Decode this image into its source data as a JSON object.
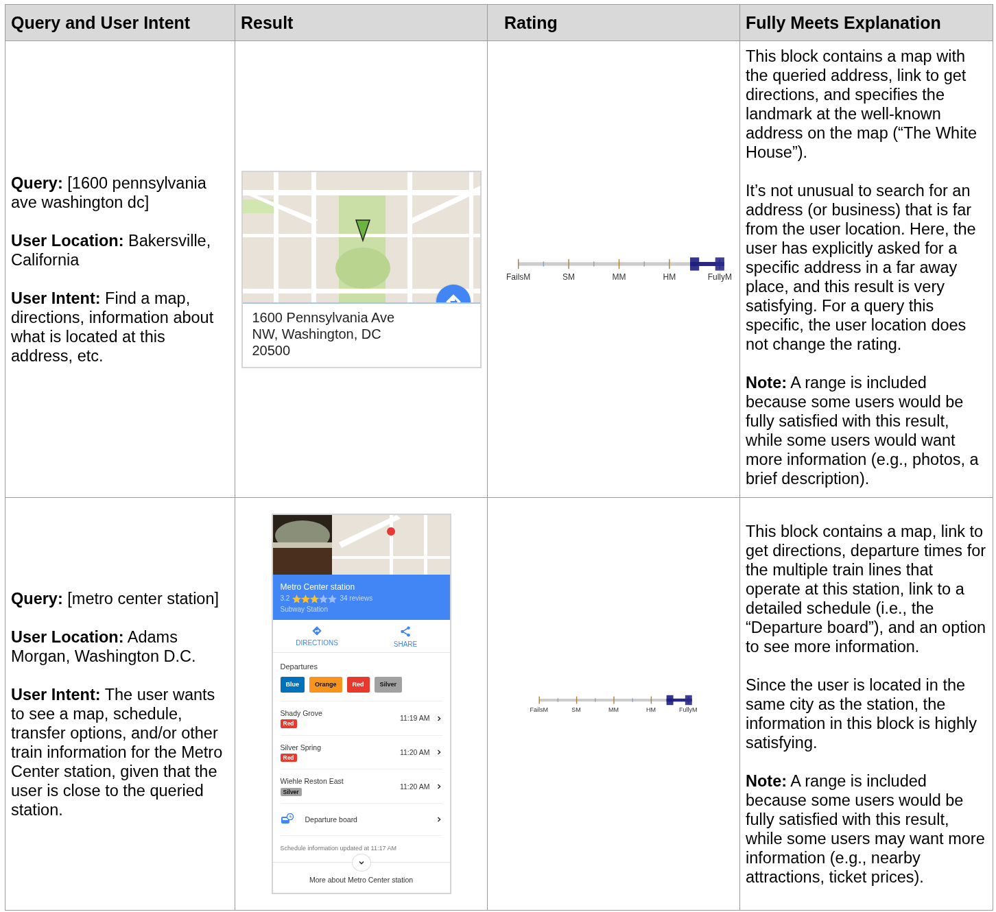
{
  "table": {
    "columns": [
      "Query and User Intent",
      "Result",
      "Rating",
      "Fully Meets Explanation"
    ],
    "rows": [
      {
        "intent": [
          "**Query:** [1600 pennsylvania ave washington dc]",
          "**User Location:** Bakersville, California",
          "**User Intent:** Find a map, directions, information about what is located at this address, etc."
        ],
        "result": {
          "kind": "address_card",
          "address": "1600 Pennsylvania Ave NW, Washington, DC 20500"
        },
        "rating": {
          "labels": [
            "FailsM",
            "SM",
            "MM",
            "HM",
            "FullyM"
          ],
          "steps": [
            {
              "selected": false
            },
            {
              "selected": false
            },
            {
              "selected": false
            },
            {
              "selected": false
            },
            {
              "selected": false
            },
            {
              "selected": false
            },
            {
              "selected": false
            },
            {
              "selected": true
            },
            {
              "selected": true
            }
          ]
        },
        "explanation": [
          "This block contains a map with the queried address, link to get directions, and specifies the landmark at the well-known address on the map (“The White House”).",
          "It’s not unusual to search for an address (or business) that is far from the user location.  Here, the user has explicitly asked for a specific address in a far away place, and this result is very satisfying.  For a query this specific, the user location does not change the rating.",
          "**Note:** A range is included because some users would be fully satisfied with this result, while some users would want more information (e.g., photos, a brief description)."
        ]
      },
      {
        "intent": [
          "**Query:** [metro center station]",
          "**User Location:** Adams Morgan, Washington D.C.",
          "**User Intent:** The user wants to see a map, schedule, transfer options, and/or other train information for the Metro Center station, given that the user is close to the queried station."
        ],
        "result": {
          "kind": "station_card",
          "title": "Metro Center station",
          "rating": "3.2",
          "stars": 3,
          "reviews": "34 reviews",
          "category": "Subway Station",
          "actions": [
            {
              "kind": "directions",
              "label": "DIRECTIONS"
            },
            {
              "kind": "share",
              "label": "SHARE"
            }
          ],
          "departures_title": "Departures",
          "lines": [
            {
              "label": "Blue",
              "color": "#0072bc"
            },
            {
              "label": "Orange",
              "color": "#f7941d"
            },
            {
              "label": "Red",
              "color": "#e8392f"
            },
            {
              "label": "Silver",
              "color": "#a1a1a1"
            }
          ],
          "departures": [
            {
              "destination": "Shady Grove",
              "line": {
                "label": "Red",
                "color": "#e8392f"
              },
              "time": "11:19 AM"
            },
            {
              "destination": "Silver Spring",
              "line": {
                "label": "Red",
                "color": "#e8392f"
              },
              "time": "11:20 AM"
            },
            {
              "destination": "Wiehle Reston East",
              "line": {
                "label": "Silver",
                "color": "#a1a1a1"
              },
              "time": "11:20 AM"
            }
          ],
          "board": "Departure board",
          "updated": "Schedule information updated at 11:17 AM",
          "more": "More about Metro Center station"
        },
        "rating": {
          "labels": [
            "FailsM",
            "SM",
            "MM",
            "HM",
            "FullyM"
          ],
          "steps": [
            {
              "selected": false
            },
            {
              "selected": false
            },
            {
              "selected": false
            },
            {
              "selected": false
            },
            {
              "selected": false
            },
            {
              "selected": false
            },
            {
              "selected": false
            },
            {
              "selected": true
            },
            {
              "selected": true
            }
          ]
        },
        "explanation": [
          "This block contains a map, link to get directions, departure times for the multiple train lines that operate at this station, link to a detailed schedule (i.e., the “Departure board”), and an option to see more information.",
          "Since the user is located in the same city as the station, the information in this block is highly satisfying.",
          "**Note:** A range is included because some users would be fully satisfied with this result, while some users may want more information (e.g., nearby attractions, ticket prices)."
        ]
      }
    ]
  }
}
